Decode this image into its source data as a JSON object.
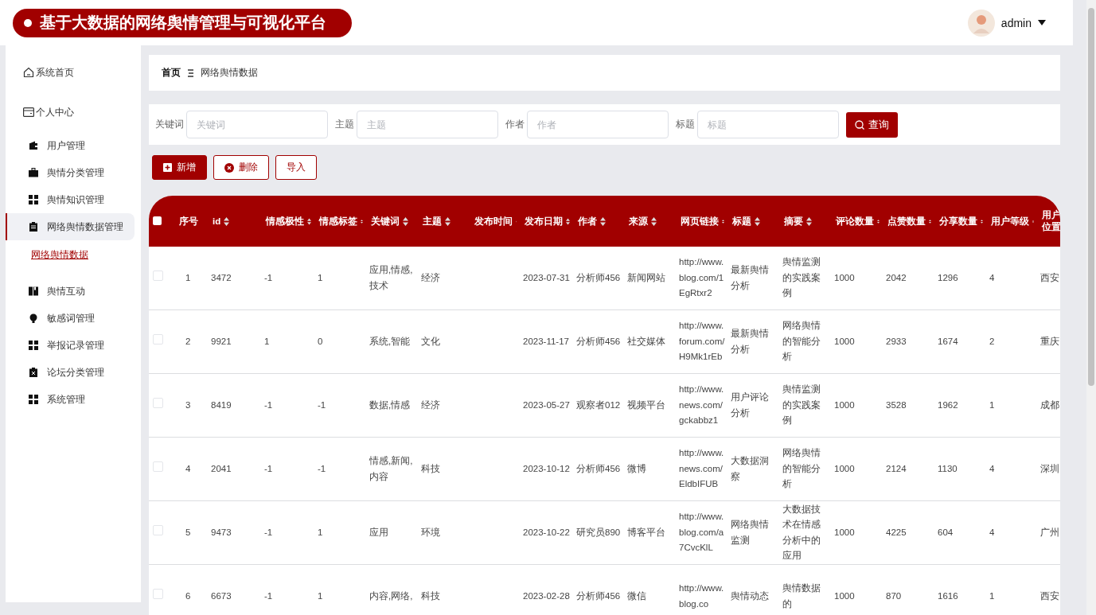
{
  "header": {
    "title": "基于大数据的网络舆情管理与可视化平台",
    "user": "admin"
  },
  "sidebar": {
    "items": [
      {
        "label": "系统首页",
        "selected": false
      },
      {
        "label": "个人中心",
        "selected": false,
        "children": [
          {
            "label": "用户管理",
            "selected": false
          },
          {
            "label": "舆情分类管理",
            "selected": false
          },
          {
            "label": "舆情知识管理",
            "selected": false
          },
          {
            "label": "网络舆情数据管理",
            "selected": true,
            "children": [
              {
                "label": "网络舆情数据",
                "selected": true
              }
            ]
          },
          {
            "label": "舆情互动",
            "selected": false
          },
          {
            "label": "敏感词管理",
            "selected": false
          },
          {
            "label": "举报记录管理",
            "selected": false
          },
          {
            "label": "论坛分类管理",
            "selected": false
          },
          {
            "label": "系统管理",
            "selected": false
          }
        ]
      }
    ]
  },
  "breadcrumb": [
    "首页",
    "网络舆情数据"
  ],
  "search": {
    "fields": [
      {
        "label": "关键词",
        "placeholder": "关键词"
      },
      {
        "label": "主题",
        "placeholder": "主题"
      },
      {
        "label": "作者",
        "placeholder": "作者"
      },
      {
        "label": "标题",
        "placeholder": "标题"
      }
    ],
    "button": "查询"
  },
  "actions": [
    {
      "label": "新增",
      "kind": "add"
    },
    {
      "label": "删除",
      "kind": "delete"
    },
    {
      "label": "导入",
      "kind": "import"
    }
  ],
  "table": {
    "all_selected": false,
    "columns": [
      {
        "label": "序号",
        "sortable": false
      },
      {
        "label": "id",
        "sortable": true
      },
      {
        "label": "情感极性",
        "sortable": true
      },
      {
        "label": "情感标签",
        "sortable": true
      },
      {
        "label": "关键词",
        "sortable": true
      },
      {
        "label": "主题",
        "sortable": true
      },
      {
        "label": "发布时间",
        "sortable": true
      },
      {
        "label": "发布日期",
        "sortable": true
      },
      {
        "label": "作者",
        "sortable": true
      },
      {
        "label": "来源",
        "sortable": true
      },
      {
        "label": "网页链接",
        "sortable": true
      },
      {
        "label": "标题",
        "sortable": true
      },
      {
        "label": "摘要",
        "sortable": true
      },
      {
        "label": "评论数量",
        "sortable": true
      },
      {
        "label": "点赞数量",
        "sortable": true
      },
      {
        "label": "分享数量",
        "sortable": true
      },
      {
        "label": "用户等级",
        "sortable": true
      },
      {
        "label": "用户位置",
        "sortable": false
      }
    ],
    "rows": [
      {
        "selected": false,
        "cells": [
          "1",
          "3472",
          "-1",
          "1",
          "应用,情感,技术",
          "经济",
          "",
          "2023-07-31",
          "分析师456",
          "新闻网站",
          "http://www.blog.com/1EgRtxr2",
          "最新舆情分析",
          "舆情监测的实践案例",
          "1000",
          "2042",
          "1296",
          "4",
          "西安"
        ]
      },
      {
        "selected": false,
        "cells": [
          "2",
          "9921",
          "1",
          "0",
          "系统,智能",
          "文化",
          "",
          "2023-11-17",
          "分析师456",
          "社交媒体",
          "http://www.forum.com/H9Mk1rEb",
          "最新舆情分析",
          "网络舆情的智能分析",
          "1000",
          "2933",
          "1674",
          "2",
          "重庆"
        ]
      },
      {
        "selected": false,
        "cells": [
          "3",
          "8419",
          "-1",
          "-1",
          "数据,情感",
          "经济",
          "",
          "2023-05-27",
          "观察者012",
          "视频平台",
          "http://www.news.com/gckabbz1",
          "用户评论分析",
          "舆情监测的实践案例",
          "1000",
          "3528",
          "1962",
          "1",
          "成都"
        ]
      },
      {
        "selected": false,
        "cells": [
          "4",
          "2041",
          "-1",
          "-1",
          "情感,新闻,内容",
          "科技",
          "",
          "2023-10-12",
          "分析师456",
          "微博",
          "http://www.news.com/EldbIFUB",
          "大数据洞察",
          "网络舆情的智能分析",
          "1000",
          "2124",
          "1130",
          "4",
          "深圳"
        ]
      },
      {
        "selected": false,
        "cells": [
          "5",
          "9473",
          "-1",
          "1",
          "应用",
          "环境",
          "",
          "2023-10-22",
          "研究员890",
          "博客平台",
          "http://www.blog.com/a7CvcKlL",
          "网络舆情监测",
          "大数据技术在情感分析中的应用",
          "1000",
          "4225",
          "604",
          "4",
          "广州"
        ]
      },
      {
        "selected": false,
        "cells": [
          "6",
          "6673",
          "-1",
          "1",
          "内容,网络,",
          "科技",
          "",
          "2023-02-28",
          "分析师456",
          "微信",
          "http://www.blog.co",
          "舆情动态",
          "舆情数据的",
          "1000",
          "870",
          "1616",
          "1",
          "西安"
        ]
      }
    ]
  }
}
